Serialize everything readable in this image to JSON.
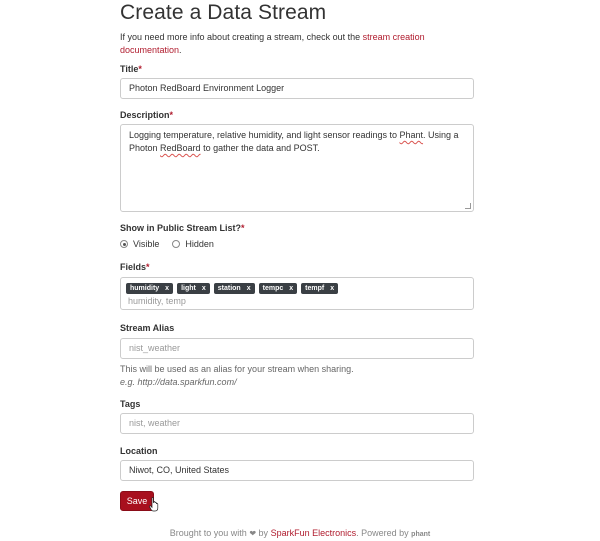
{
  "page_title": "Create a Data Stream",
  "intro": {
    "text": "If you need more info about creating a stream, check out the ",
    "link": "stream creation documentation",
    "end": "."
  },
  "title_field": {
    "label": "Title",
    "required_mark": "*",
    "value": "Photon RedBoard Environment Logger"
  },
  "description_field": {
    "label": "Description",
    "required_mark": "*",
    "value_part1": "Logging temperature, relative humidity, and light sensor readings to ",
    "value_phant": "Phant",
    "value_part2": ". Using a Photon ",
    "value_redboard": "RedBoard",
    "value_part3": " to gather the data and POST."
  },
  "visibility_field": {
    "label": "Show in Public Stream List?",
    "required_mark": "*",
    "options": [
      "Visible",
      "Hidden"
    ],
    "selected": "Visible"
  },
  "fields_field": {
    "label": "Fields",
    "required_mark": "*",
    "tags": [
      "humidity",
      "light",
      "station",
      "tempc",
      "tempf"
    ],
    "tag_remove": "x",
    "placeholder": "humidity, temp"
  },
  "alias_field": {
    "label": "Stream Alias",
    "placeholder": "nist_weather",
    "help": "This will be used as an alias for your stream when sharing.",
    "example": "e.g. http://data.sparkfun.com/"
  },
  "tags_field": {
    "label": "Tags",
    "placeholder": "nist, weather"
  },
  "location_field": {
    "label": "Location",
    "value": "Niwot, CO, United States"
  },
  "save_label": "Save",
  "footer": {
    "prefix": "Brought to you with",
    "by": "by",
    "company": "SparkFun Electronics",
    "powered": ". Powered by",
    "powered_logo": "phant"
  },
  "colors": {
    "accent": "#b01c2e",
    "button": "#a8101e",
    "tag_bg": "#3a3f44"
  }
}
